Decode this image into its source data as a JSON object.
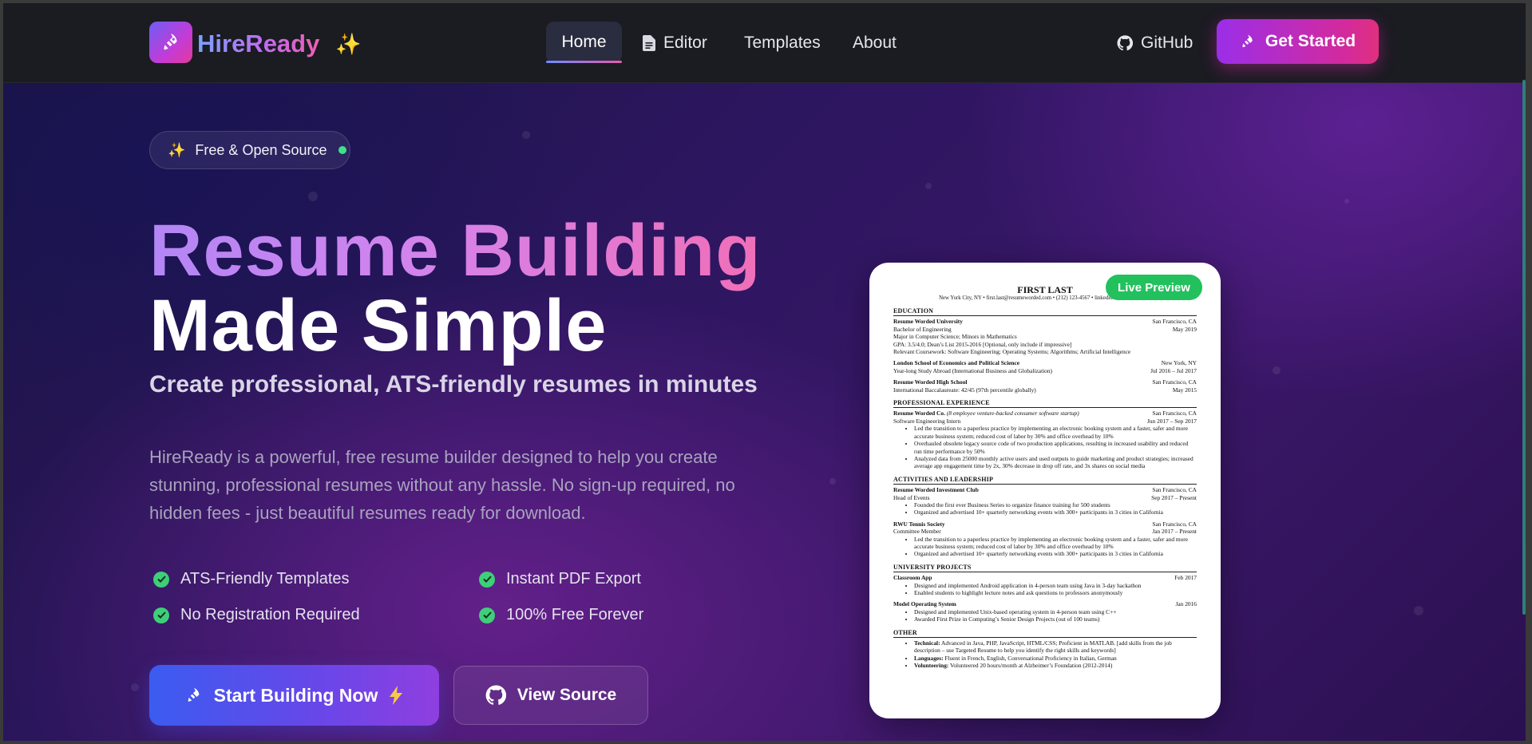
{
  "nav": {
    "brand": "HireReady",
    "links": [
      "Home",
      "Editor",
      "Templates",
      "About"
    ],
    "github": "GitHub",
    "cta": "Get Started"
  },
  "hero": {
    "badge": "Free & Open Source",
    "title_line1": "Resume Building",
    "title_line2": "Made Simple",
    "subtitle": "Create professional, ATS-friendly resumes in minutes",
    "description": "HireReady is a powerful, free resume builder designed to help you create stunning, professional resumes without any hassle. No sign-up required, no hidden fees - just beautiful resumes ready for download.",
    "features": [
      "ATS-Friendly Templates",
      "Instant PDF Export",
      "No Registration Required",
      "100% Free Forever"
    ],
    "primary_button": "Start Building Now",
    "secondary_button": "View Source"
  },
  "preview": {
    "badge": "Live Preview",
    "resume": {
      "name": "FIRST LAST",
      "contact": "New York City, NY • first.last@resumeworded.com • (212) 123-4567 • linkedin.com/in/username",
      "education_title": "EDUCATION",
      "edu1": {
        "school": "Resume Worded University",
        "location": "San Francisco, CA",
        "degree": "Bachelor of Engineering",
        "date": "May 2019",
        "line1": "Major in Computer Science; Minors in Mathematics",
        "line2": "GPA: 3.5/4.0; Dean’s List 2015-2016 [Optional, only include if impressive]",
        "line3": "Relevant Coursework: Software Engineering; Operating Systems; Algorithms; Artificial Intelligence"
      },
      "edu2": {
        "school": "London School of Economics and Political Science",
        "location": "New York, NY",
        "detail": "Year-long Study Abroad (International Business and Globalization)",
        "date": "Jul 2016 – Jul 2017"
      },
      "edu3": {
        "school": "Resume Worded High School",
        "location": "San Francisco, CA",
        "detail": "International Baccalaureate: 42/45 (97th percentile globally)",
        "date": "May 2015"
      },
      "experience_title": "PROFESSIONAL EXPERIENCE",
      "exp1": {
        "company": "Resume Worded Co.",
        "company_note": "(8 employee venture-backed consumer software startup)",
        "location": "San Francisco, CA",
        "role": "Software Engineering Intern",
        "date": "Jun 2017 – Sep 2017",
        "bullets": [
          "Led the transition to a paperless practice by implementing an electronic booking system and a faster, safer and more accurate business system; reduced cost of labor by 30% and office overhead by 10%",
          "Overhauled obsolete legacy source code of two production applications, resulting in increased usability and reduced run time performance by 50%",
          "Analyzed data from 25000 monthly active users and used outputs to guide marketing and product strategies; increased average app engagement time by 2x, 30% decrease in drop off rate, and 3x shares on social media"
        ]
      },
      "activities_title": "ACTIVITIES AND LEADERSHIP",
      "act1": {
        "org": "Resume Worded Investment Club",
        "location": "San Francisco, CA",
        "role": "Head of Events",
        "date": "Sep 2017 – Present",
        "bullets": [
          "Founded the first ever Business Series to organize finance training for 500 students",
          "Organized and advertised 10+ quarterly networking events with 300+ participants in 3 cities in California"
        ]
      },
      "act2": {
        "org": "RWU Tennis Society",
        "location": "San Francisco, CA",
        "role": "Committee Member",
        "date": "Jan 2017 – Present",
        "bullets": [
          "Led the transition to a paperless practice by implementing an electronic booking system and a faster, safer and more accurate business system; reduced cost of labor by 30% and office overhead by 10%",
          "Organized and advertised 10+ quarterly networking events with 300+ participants in 3 cities in California"
        ]
      },
      "projects_title": "UNIVERSITY PROJECTS",
      "proj1": {
        "name": "Classroom App",
        "date": "Feb 2017",
        "bullets": [
          "Designed and implemented Android application in 4-person team using Java in 3-day hackathon",
          "Enabled students to highlight lecture notes and ask questions to professors anonymously"
        ]
      },
      "proj2": {
        "name": "Model Operating System",
        "date": "Jan 2016",
        "bullets": [
          "Designed and implemented Unix-based operating system in 4-person team using C++",
          "Awarded First Prize in Computing’s Senior Design Projects (out of 100 teams)"
        ]
      },
      "other_title": "OTHER",
      "other": [
        {
          "label": "Technical:",
          "text": "Advanced in Java, PHP, JavaScript, HTML/CSS; Proficient in MATLAB. [add skills from the job description – use Targeted Resume to help you identify the right skills and keywords]"
        },
        {
          "label": "Languages:",
          "text": "Fluent in French, English, Conversational Proficiency in Italian, German"
        },
        {
          "label": "Volunteering:",
          "text": "Volunteered 20 hours/month at Alzheimer’s Foundation (2012-2014)"
        }
      ]
    }
  },
  "colors": {
    "accent_pink": "#e0307e",
    "accent_purple": "#9b2ee8",
    "accent_blue": "#3b5cf0",
    "success_green": "#22c15d"
  },
  "icons": {
    "logo": "rocket-icon",
    "brand_sparkle": "sparkles-icon",
    "editor": "document-icon",
    "github": "github-icon",
    "feature": "check-circle-icon",
    "cta": "bolt-icon"
  }
}
